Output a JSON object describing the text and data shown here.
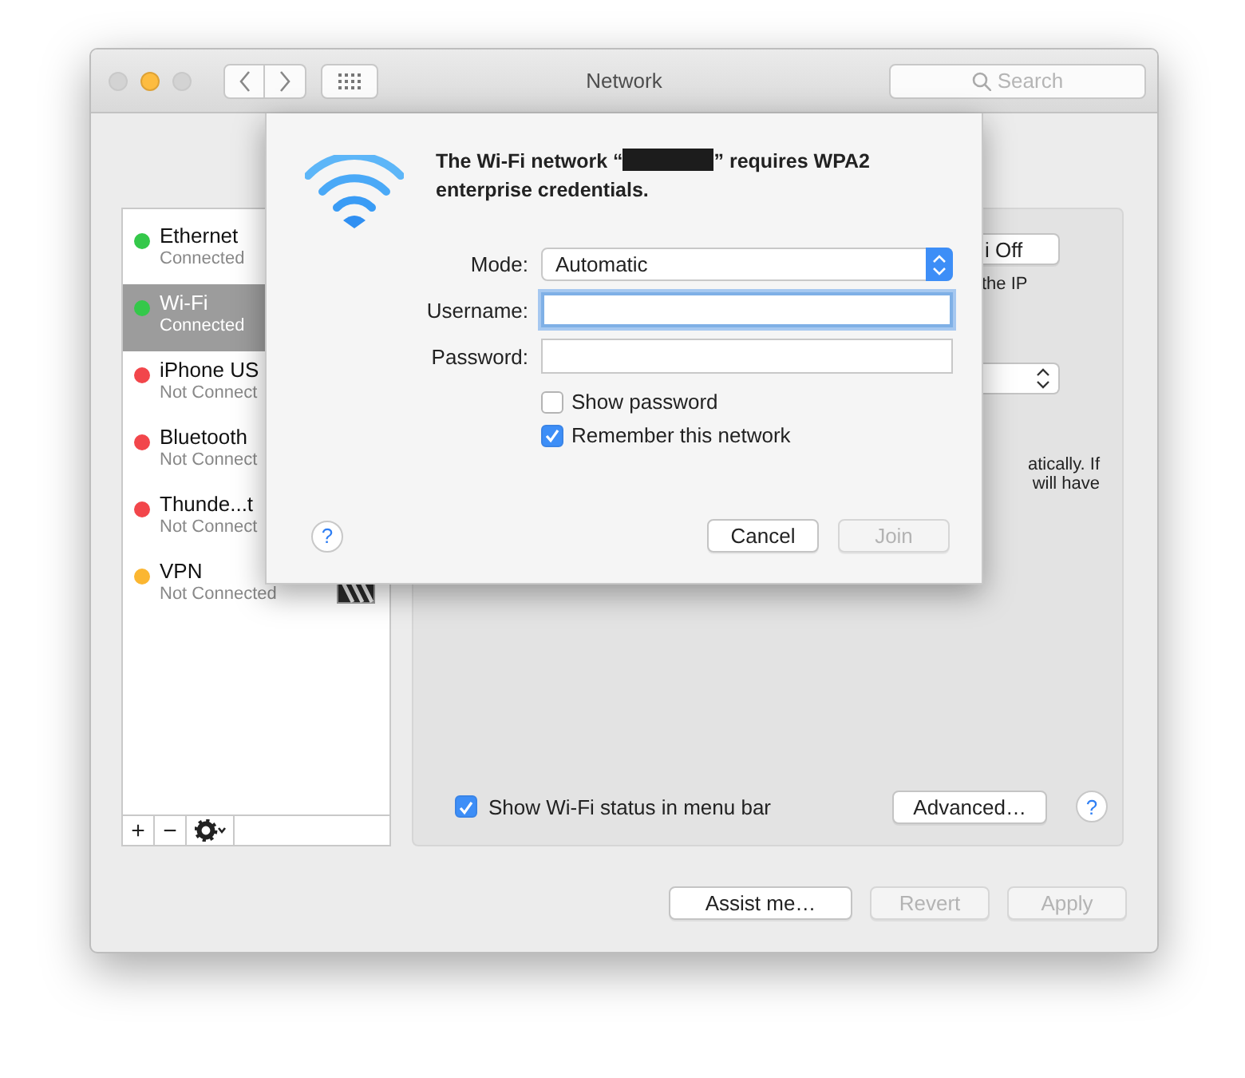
{
  "window": {
    "title": "Network",
    "traffic_lights": [
      {
        "kind": "close",
        "enabled": false
      },
      {
        "kind": "minimize",
        "enabled": true
      },
      {
        "kind": "zoom",
        "enabled": false
      }
    ]
  },
  "toolbar": {
    "search": {
      "placeholder": "Search"
    }
  },
  "sidebar": {
    "items": [
      {
        "name": "Ethernet",
        "status": "Connected",
        "color": "#34c84a",
        "selected": false,
        "striped_icon": false
      },
      {
        "name": "Wi-Fi",
        "status": "Connected",
        "color": "#34c84a",
        "selected": true,
        "striped_icon": false
      },
      {
        "name": "iPhone US",
        "status": "Not Connect",
        "color": "#f2464b",
        "selected": false,
        "striped_icon": false
      },
      {
        "name": "Bluetooth",
        "status": "Not Connect",
        "color": "#f2464b",
        "selected": false,
        "striped_icon": false
      },
      {
        "name": "Thunde...t",
        "status": "Not Connect",
        "color": "#f2464b",
        "selected": false,
        "striped_icon": false
      },
      {
        "name": "VPN",
        "status": "Not Connected",
        "color": "#fbb631",
        "selected": false,
        "striped_icon": true
      }
    ],
    "add_button": "+",
    "remove_button": "−"
  },
  "panel": {
    "power_button": "i Off",
    "text_1": "the IP",
    "text_2": "atically. If",
    "text_3": "will have",
    "show_status": {
      "label": "Show Wi-Fi status in menu bar",
      "checked": true
    },
    "advanced_button": "Advanced…",
    "help_button": "?"
  },
  "sheet": {
    "message_before": "The Wi-Fi network “",
    "message_after": "” requires WPA2 enterprise credentials.",
    "fields": [
      {
        "kind": "select",
        "label": "Mode:",
        "value": "Automatic"
      },
      {
        "kind": "text",
        "label": "Username:",
        "focused": true
      },
      {
        "kind": "password",
        "label": "Password:",
        "focused": false
      }
    ],
    "options": [
      {
        "label": "Show password",
        "checked": false
      },
      {
        "label": "Remember this network",
        "checked": true
      }
    ],
    "help_button": "?",
    "buttons": [
      {
        "label": "Cancel",
        "disabled": false
      },
      {
        "label": "Join",
        "disabled": true
      }
    ]
  },
  "footer": {
    "buttons": [
      {
        "label": "Assist me…",
        "disabled": false
      },
      {
        "label": "Revert",
        "disabled": true
      },
      {
        "label": "Apply",
        "disabled": true
      }
    ]
  }
}
